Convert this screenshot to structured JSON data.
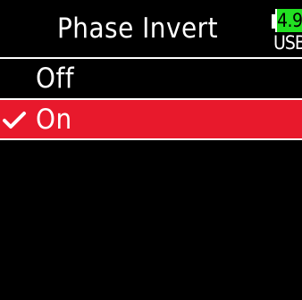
{
  "header": {
    "title": "Phase Invert"
  },
  "status": {
    "battery_value": "4.9",
    "power_source": "USB",
    "battery_color": "#22e022"
  },
  "options": [
    {
      "label": "Off",
      "selected": false
    },
    {
      "label": "On",
      "selected": true,
      "icon": "check-icon"
    }
  ],
  "colors": {
    "background": "#000000",
    "text": "#ffffff",
    "selection": "#e8192c"
  }
}
